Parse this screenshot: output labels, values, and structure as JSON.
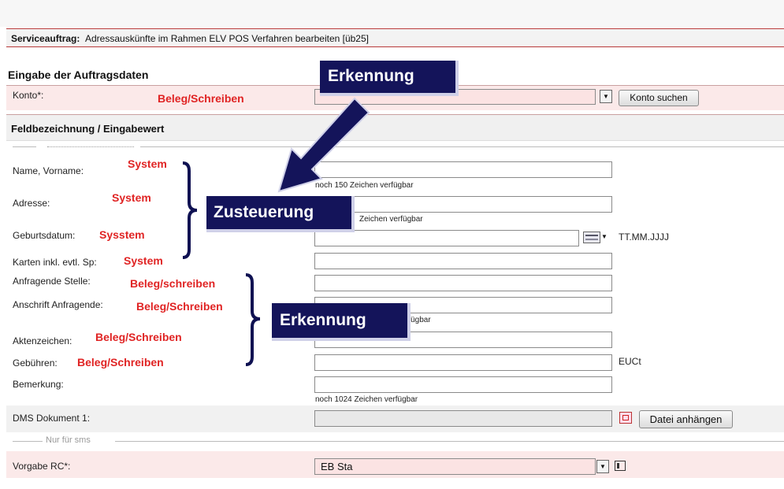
{
  "service": {
    "label": "Serviceauftrag:",
    "text": "Adressauskünfte im Rahmen ELV POS Verfahren bearbeiten [üb25]"
  },
  "section_title": "Eingabe der Auftragsdaten",
  "konto": {
    "label": "Konto*:",
    "annotation": "Beleg/Schreiben",
    "button": "Konto suchen"
  },
  "feld_header": "Feldbezeichnung / Eingabewert",
  "fields": {
    "name": {
      "label": "Name, Vorname:",
      "annotation": "System",
      "hint": "noch 150 Zeichen verfügbar"
    },
    "adresse": {
      "label": "Adresse:",
      "annotation": "System",
      "hint": "Zeichen verfügbar"
    },
    "geburtsdatum": {
      "label": "Geburtsdatum:",
      "annotation": "Sysstem",
      "format": "TT.MM.JJJJ"
    },
    "karten": {
      "label": "Karten inkl. evtl. Sp:",
      "annotation": "System"
    },
    "anfragende_stelle": {
      "label": "Anfragende Stelle:",
      "annotation": "Beleg/schreiben"
    },
    "anschrift": {
      "label": "Anschrift Anfragende:",
      "annotation": "Beleg/Schreiben",
      "hint": "rfügbar"
    },
    "aktenzeichen": {
      "label": "Aktenzeichen:",
      "annotation": "Beleg/Schreiben"
    },
    "gebuehren": {
      "label": "Gebühren:",
      "annotation": "Beleg/Schreiben",
      "unit": "EUCt"
    },
    "bemerkung": {
      "label": "Bemerkung:",
      "hint": "noch 1024 Zeichen verfügbar"
    },
    "dms": {
      "label": "DMS Dokument 1:",
      "button": "Datei anhängen"
    }
  },
  "sms_section": "Nur für sms",
  "vorgabe": {
    "label": "Vorgabe RC*:",
    "value": "EB Sta"
  },
  "callouts": {
    "erkennung_top": "Erkennung",
    "zusteuerung": "Zusteuerung",
    "erkennung_mid": "Erkennung"
  },
  "colors": {
    "annotation_red": "#e02424",
    "callout_navy": "#14145a",
    "required_pink": "#fbe9e9",
    "border_red": "#b83a3a"
  }
}
